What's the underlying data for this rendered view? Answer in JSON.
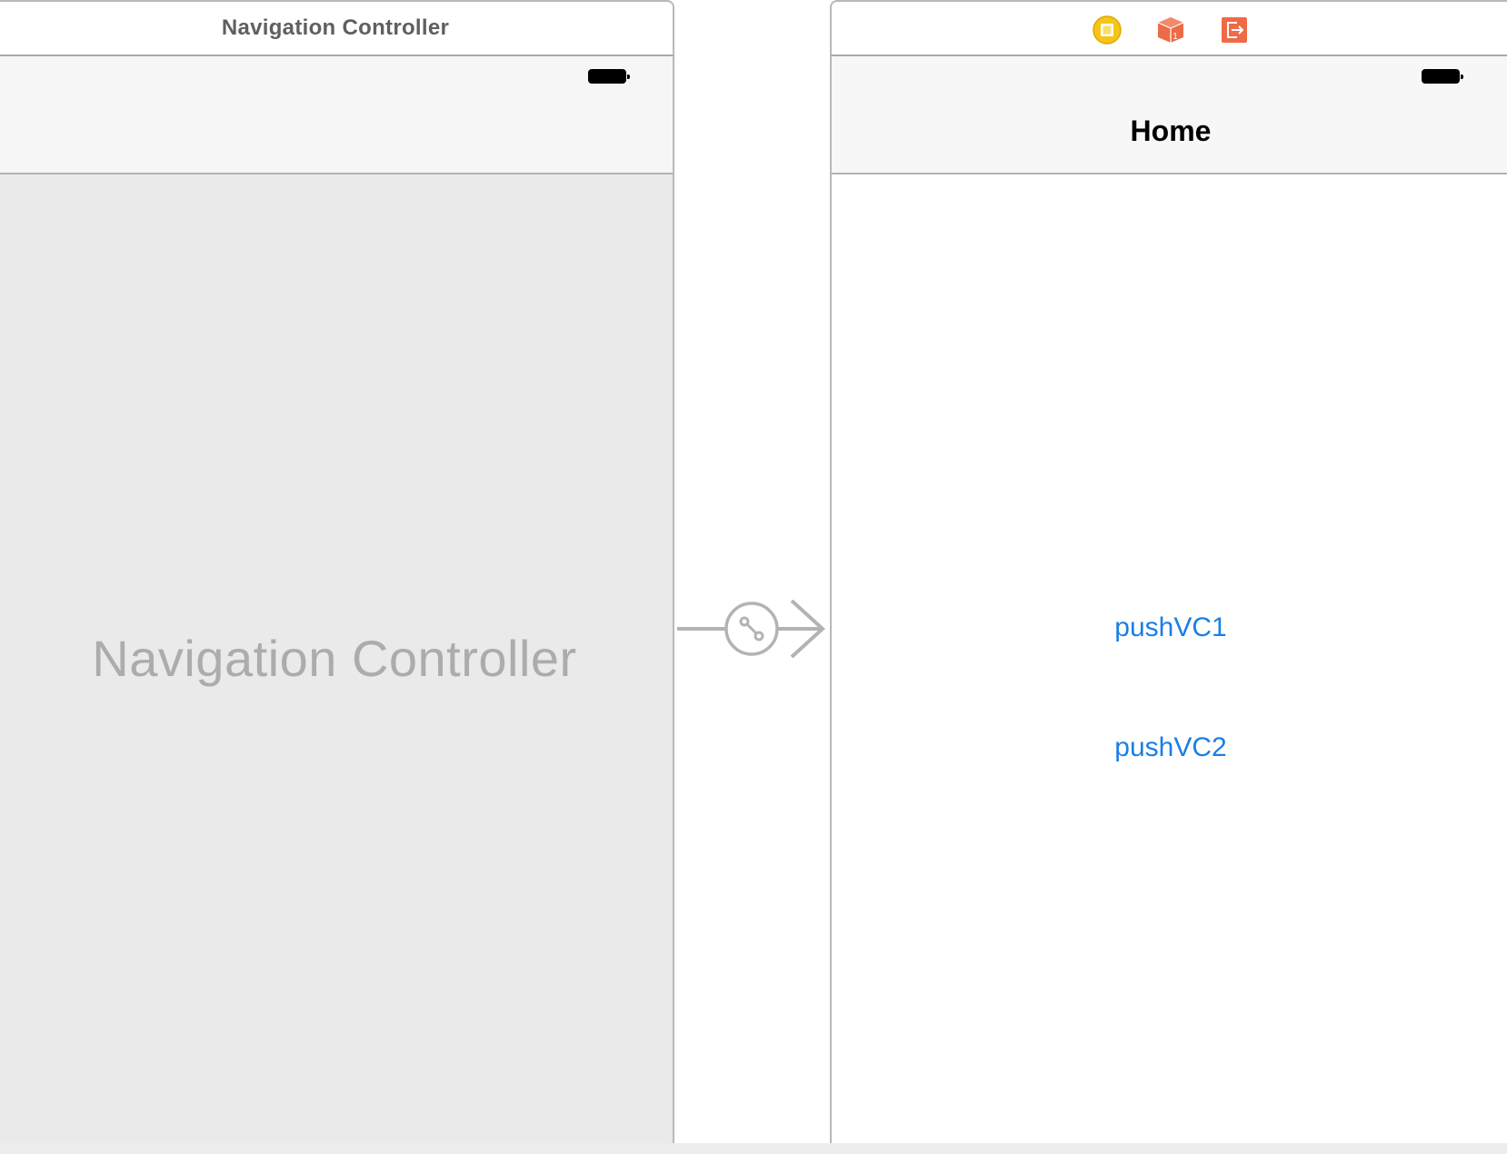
{
  "nav_controller_scene": {
    "title": "Navigation Controller",
    "placeholder_label": "Navigation Controller"
  },
  "home_scene": {
    "dock_icons": [
      "view-controller-icon",
      "first-responder-icon",
      "exit-icon"
    ],
    "nav_title": "Home",
    "buttons": [
      {
        "label": "pushVC1"
      },
      {
        "label": "pushVC2"
      }
    ]
  },
  "segue": {
    "icon": "segue-relationship-icon"
  },
  "colors": {
    "canvas": "#ffffff",
    "scene_border": "#b9b9b9",
    "placeholder_text": "#acacac",
    "nav_placeholder_bg": "#eaeaea",
    "segue": "#b3b3b3",
    "button_tint": "#1a7fe5",
    "vc_icon": "#f5c518",
    "first_responder_icon": "#ee6b47",
    "exit_icon": "#ef6a45"
  }
}
